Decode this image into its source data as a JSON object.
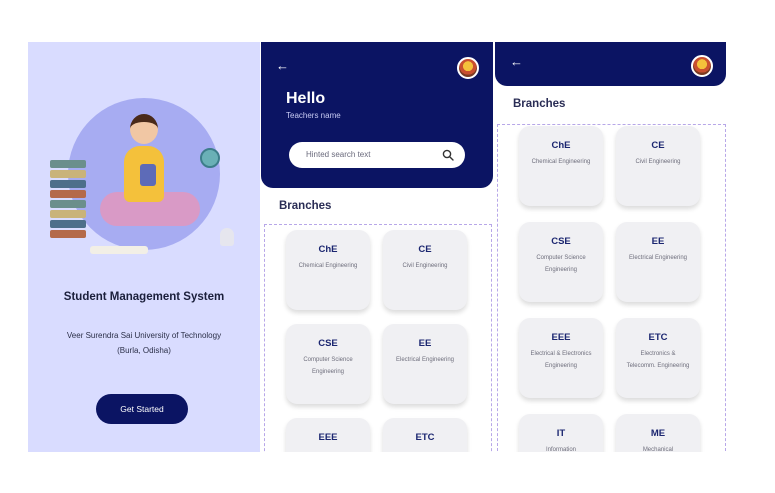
{
  "splash": {
    "title": "Student Management System",
    "university": "Veer Surendra Sai University of Technology",
    "location": "(Burla, Odisha)",
    "cta_label": "Get Started"
  },
  "home": {
    "greeting": "Hello",
    "teacher_name": "Teachers name",
    "search_placeholder": "Hinted search text",
    "section_title": "Branches",
    "branches": [
      {
        "code": "ChE",
        "name": "Chemical Engineering"
      },
      {
        "code": "CE",
        "name": "Civil Engineering"
      },
      {
        "code": "CSE",
        "name": "Computer Science Engineering"
      },
      {
        "code": "EE",
        "name": "Electrical Engineering"
      },
      {
        "code": "EEE",
        "name": ""
      },
      {
        "code": "ETC",
        "name": ""
      }
    ]
  },
  "branches_screen": {
    "section_title": "Branches",
    "branches": [
      {
        "code": "ChE",
        "name": "Chemical Engineering"
      },
      {
        "code": "CE",
        "name": "Civil Engineering"
      },
      {
        "code": "CSE",
        "name": "Computer Science Engineering"
      },
      {
        "code": "EE",
        "name": "Electrical Engineering"
      },
      {
        "code": "EEE",
        "name": "Electrical & Electronics Engineering"
      },
      {
        "code": "ETC",
        "name": "Electronics & Telecomm. Engineering"
      },
      {
        "code": "IT",
        "name": "Information"
      },
      {
        "code": "ME",
        "name": "Mechanical"
      }
    ]
  },
  "icons": {
    "back": "arrow-left-icon",
    "search": "search-icon",
    "avatar": "user-avatar"
  },
  "colors": {
    "primary": "#0b1463",
    "splash_bg": "#d9dcff",
    "card_bg": "#f0f0f3",
    "branch_code": "#1b2670"
  }
}
